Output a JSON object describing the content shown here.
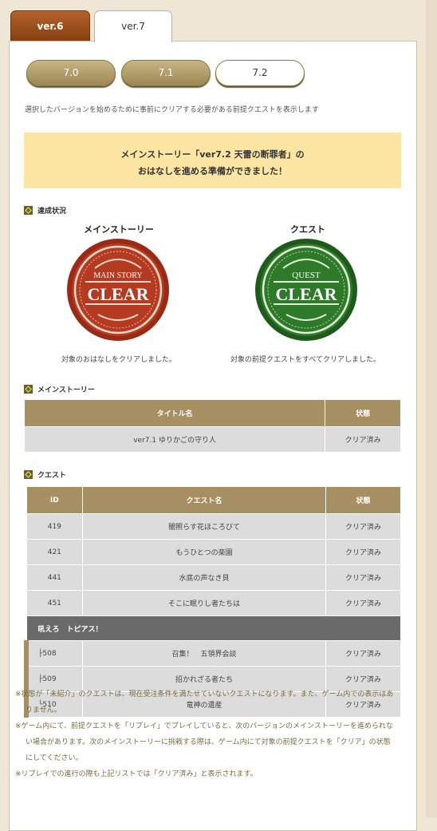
{
  "tabs": [
    {
      "label": "ver.6",
      "active": false
    },
    {
      "label": "ver.7",
      "active": true
    }
  ],
  "version_buttons": [
    {
      "label": "7.0",
      "active": false
    },
    {
      "label": "7.1",
      "active": false
    },
    {
      "label": "7.2",
      "active": true
    }
  ],
  "description": "選択したバージョンを始めるために事前にクリアする必要がある前提クエストを表示します",
  "notice": {
    "line1": "メインストーリー「ver7.2 天雷の断罪者」の",
    "line2": "おはなしを進める準備ができました！"
  },
  "status_section": {
    "title": "達成状況",
    "main": {
      "title": "メインストーリー",
      "stamp_top": "MAIN STORY",
      "stamp_word": "CLEAR",
      "caption": "対象のおはなしをクリアしました。",
      "color": "#b23a22"
    },
    "quest": {
      "title": "クエスト",
      "stamp_top": "QUEST",
      "stamp_word": "CLEAR",
      "caption": "対象の前提クエストをすべてクリアしました。",
      "color": "#2f7a2a"
    }
  },
  "main_story": {
    "title": "メインストーリー",
    "headers": [
      "タイトル名",
      "状態"
    ],
    "rows": [
      {
        "name": "ver7.1 ゆりかごの守り人",
        "status": "クリア済み"
      }
    ]
  },
  "quests": {
    "title": "クエスト",
    "headers": [
      "ID",
      "クエスト名",
      "状態"
    ],
    "rows": [
      {
        "id": "419",
        "name": "闇照らす花ほころびて",
        "status": "クリア済み"
      },
      {
        "id": "421",
        "name": "もうひとつの楽園",
        "status": "クリア済み"
      },
      {
        "id": "441",
        "name": "水底の声なき貝",
        "status": "クリア済み"
      },
      {
        "id": "451",
        "name": "そこに眠りし者たちは",
        "status": "クリア済み"
      }
    ],
    "group": {
      "title": "吼えろ　トピアス！",
      "rows": [
        {
          "id": "├508",
          "name": "召集！　五領界会談",
          "status": "クリア済み"
        },
        {
          "id": "├509",
          "name": "招かれざる者たち",
          "status": "クリア済み"
        },
        {
          "id": "└510",
          "name": "竜神の遺産",
          "status": "クリア済み"
        }
      ]
    }
  },
  "notes": [
    "※状態が「未紹介」のクエストは、現在受注条件を満たせていないクエストになります。また、ゲーム内での表示はありません。",
    "※ゲーム内にて、前提クエストを「リプレイ」でプレイしていると、次のバージョンのメインストーリーを進められない場合があります。次のメインストーリーに挑戦する際は、ゲーム内にて対象の前提クエストを「クリア」の状態にしてください。",
    "※リプレイでの進行の際も上記リストでは「クリア済み」と表示されます。"
  ],
  "colors": {
    "header": "#a68f62",
    "notice_bg": "#fde6a3",
    "active_tab_brown": "#874010"
  }
}
